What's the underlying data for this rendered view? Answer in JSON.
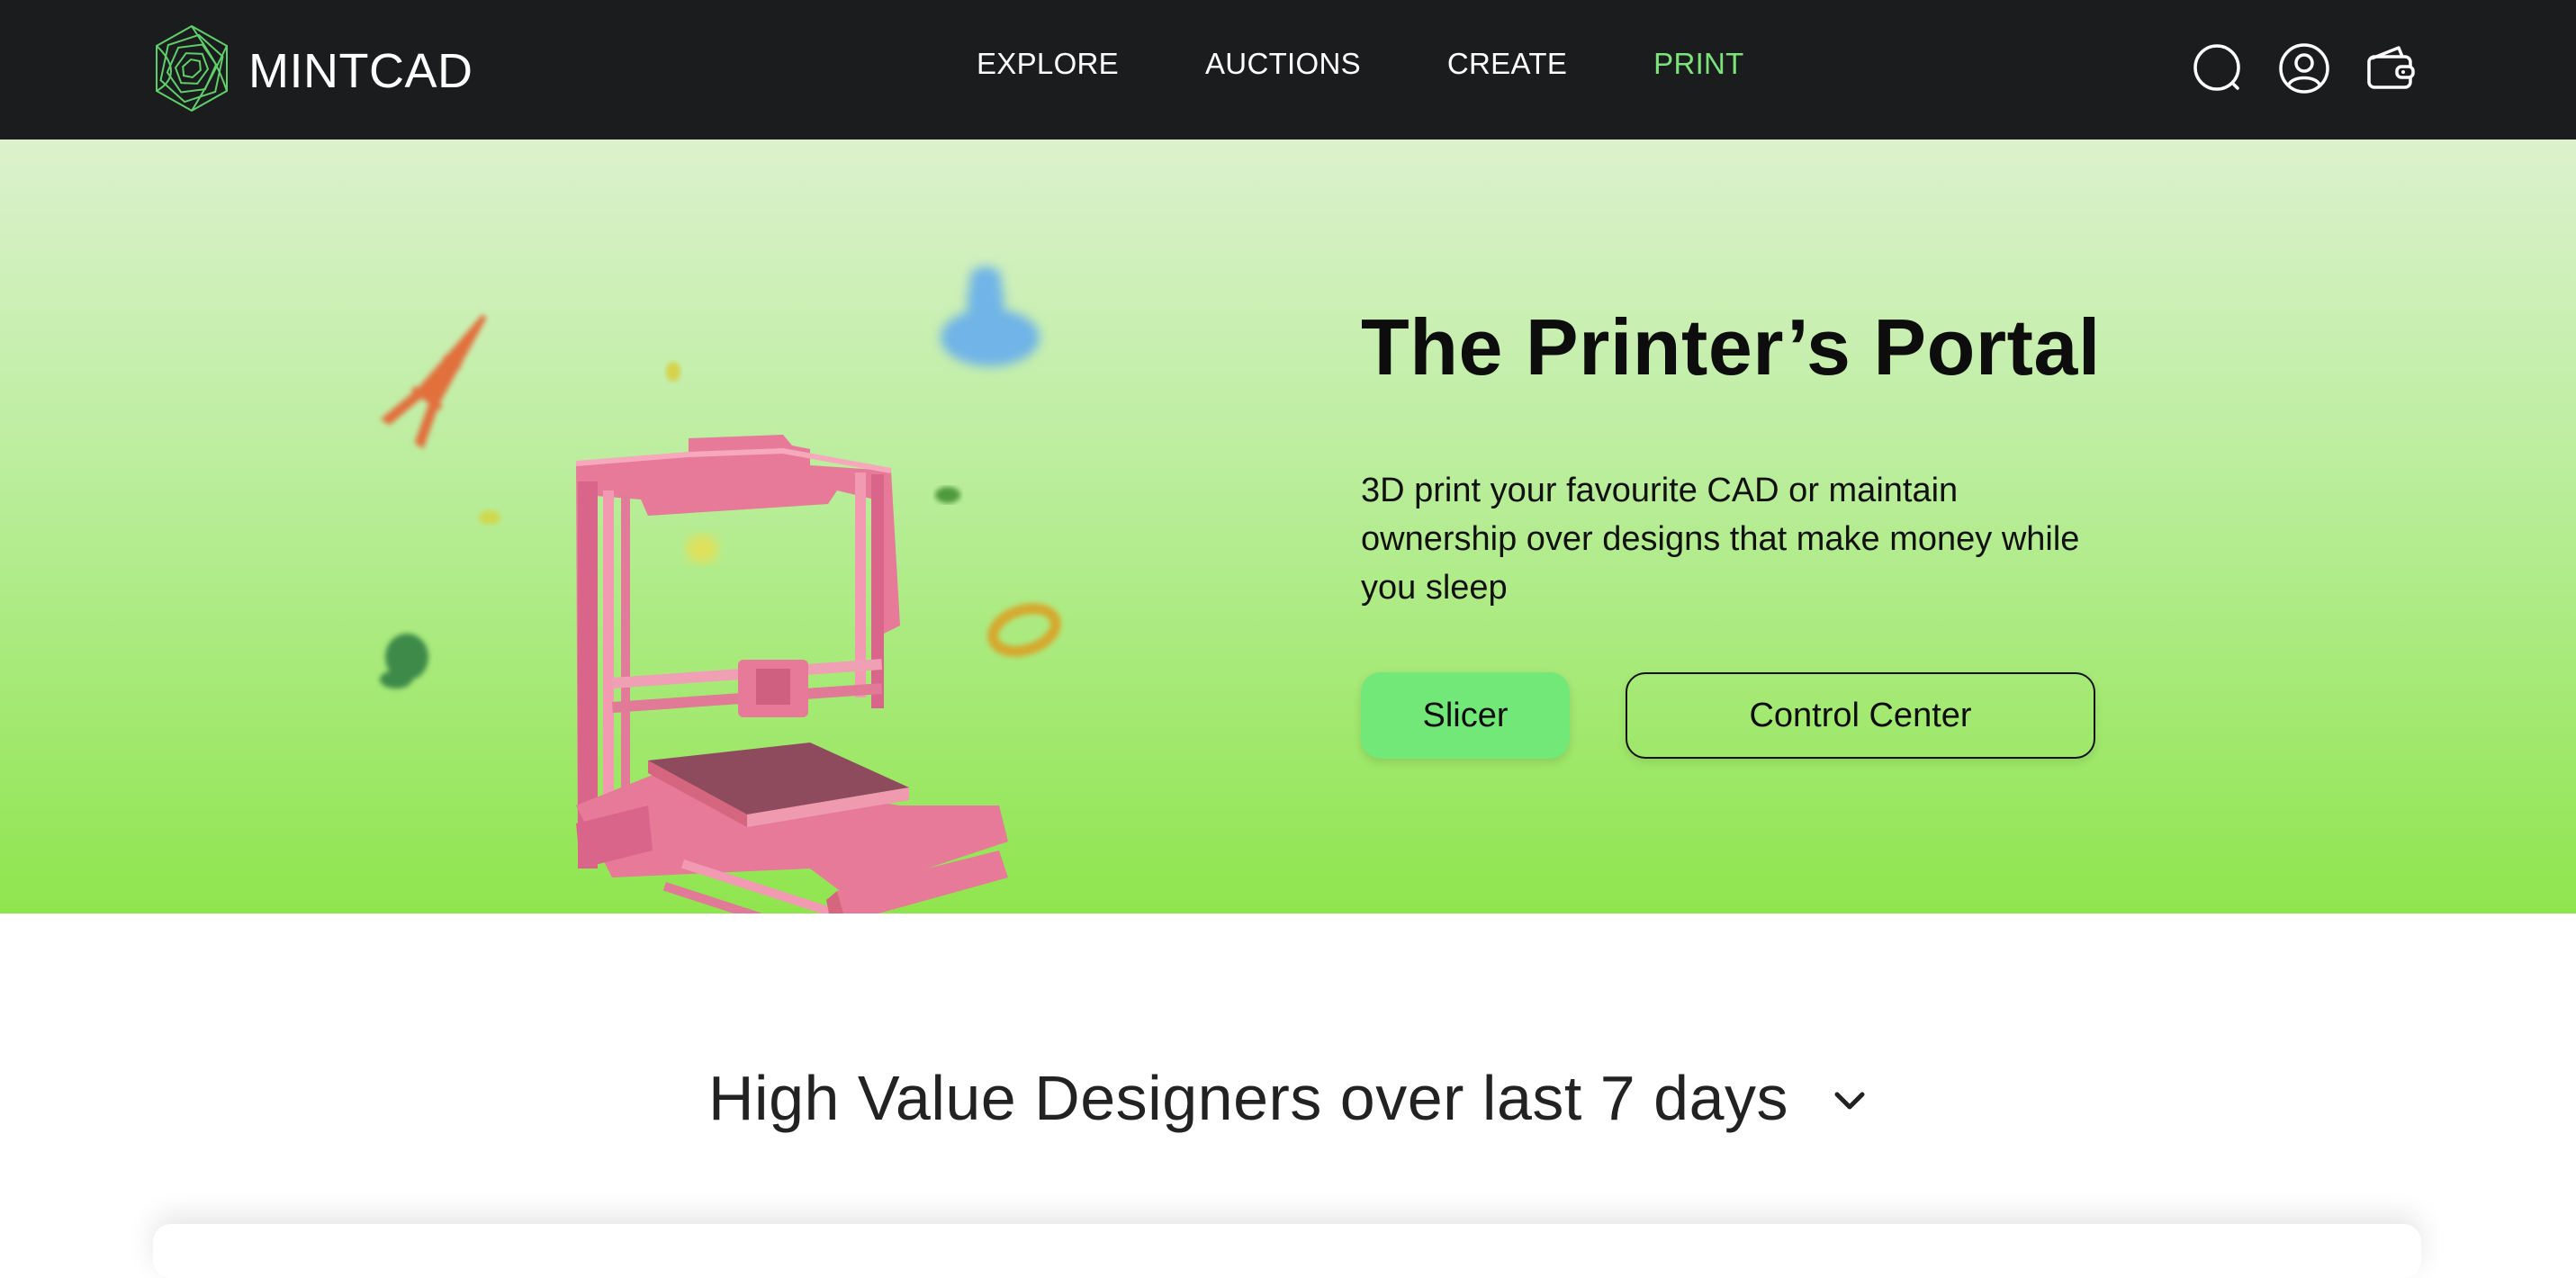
{
  "brand": {
    "name": "MINTCAD",
    "logo_icon": "hexagon-spiral-logo",
    "accent": "#7ce37c"
  },
  "nav": {
    "links": [
      {
        "label": "EXPLORE",
        "active": false
      },
      {
        "label": "AUCTIONS",
        "active": false
      },
      {
        "label": "CREATE",
        "active": false
      },
      {
        "label": "PRINT",
        "active": true
      }
    ],
    "icons": [
      "search-icon",
      "user-icon",
      "wallet-icon"
    ]
  },
  "hero": {
    "title": "The Printer’s Portal",
    "description": "3D print your favourite CAD or maintain ownership over designs that make money while you sleep",
    "primary_button": "Slicer",
    "secondary_button": "Control Center",
    "colors": {
      "gradient_top": "#dcf1cd",
      "gradient_bottom": "#8fe54e",
      "slicer_button": "#72e878"
    }
  },
  "section": {
    "title": "High Value Designers over last 7 days",
    "dropdown_icon": "chevron-down-icon"
  }
}
